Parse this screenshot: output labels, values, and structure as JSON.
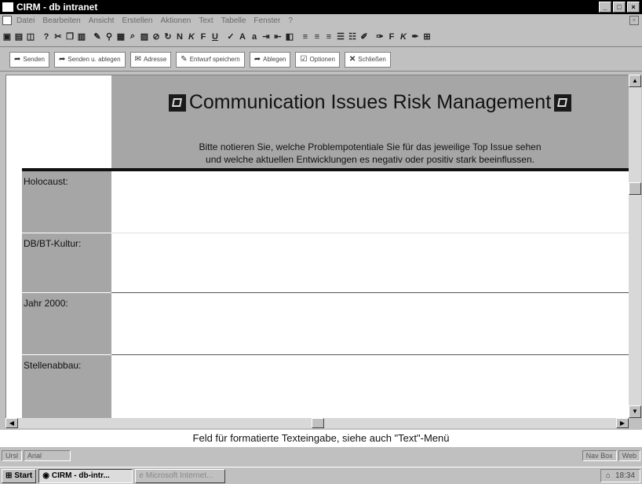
{
  "window": {
    "title": "CIRM - db intranet"
  },
  "menu": [
    "Datei",
    "Bearbeiten",
    "Ansicht",
    "Erstellen",
    "Aktionen",
    "Text",
    "Tabelle",
    "Fenster",
    "?"
  ],
  "toolbar_icons": [
    "save-icon",
    "print-icon",
    "preview-icon",
    "help-icon",
    "cut-icon",
    "copy-icon",
    "paste-icon",
    "pen-icon",
    "link-icon",
    "table-icon",
    "find-icon",
    "image-icon",
    "attach-icon",
    "refresh-icon",
    "bold-icon",
    "italic-icon",
    "underline-icon",
    "spell-icon",
    "align-left-icon",
    "align-center-icon",
    "align-right-icon",
    "list-icon",
    "indent-icon",
    "color-icon"
  ],
  "toolbar_glyphs": {
    "bold": "F",
    "italic": "K",
    "underline": "U",
    "n": "N"
  },
  "actions": [
    {
      "label": "Senden",
      "icon": "send-icon"
    },
    {
      "label": "Senden u. ablegen",
      "icon": "send-file-icon"
    },
    {
      "label": "Adresse",
      "icon": "address-icon"
    },
    {
      "label": "Entwurf speichern",
      "icon": "draft-icon"
    },
    {
      "label": "Ablegen",
      "icon": "folder-icon"
    },
    {
      "label": "Optionen",
      "icon": "options-icon"
    },
    {
      "label": "Schließen",
      "icon": "close-x-icon"
    }
  ],
  "document": {
    "title": "Communication Issues Risk Management",
    "instructions_line1": "Bitte notieren Sie, welche Problempotentiale Sie für das jeweilige Top Issue sehen",
    "instructions_line2": "und welche aktuellen Entwicklungen es negativ oder positiv stark beeinflussen.",
    "rows": [
      {
        "label": "Holocaust:"
      },
      {
        "label": "DB/BT-Kultur:"
      },
      {
        "label": "Jahr 2000:"
      },
      {
        "label": "Stellenabbau:"
      }
    ]
  },
  "status_message": "Feld für formatierte Texteingabe, siehe auch \"Text\"-Menü",
  "statusbar": {
    "left1": "Ursl",
    "left2": "Arial",
    "right1": "Nav Box",
    "right2": "Web"
  },
  "taskbar": {
    "start": "Start",
    "tasks": [
      "CIRM - db-intr...",
      "Microsoft Internet..."
    ],
    "clock": "18:34"
  }
}
